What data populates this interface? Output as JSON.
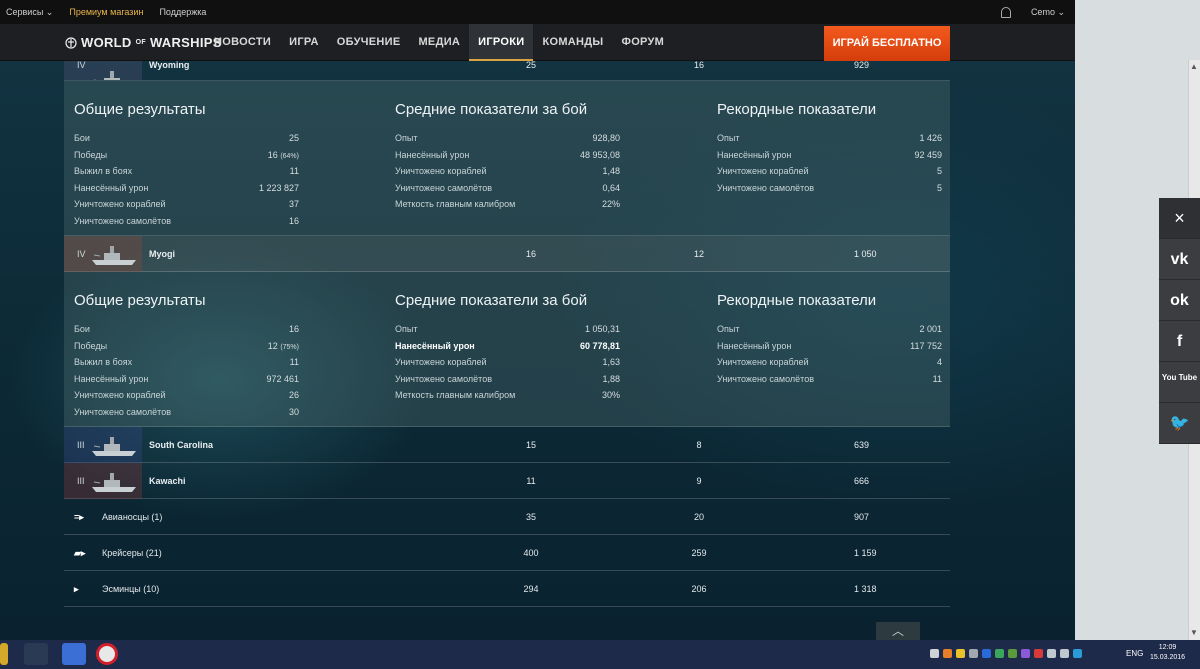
{
  "topbar": {
    "services": "Сервисы ⌄",
    "premium": "Премиум магазин",
    "support": "Поддержка",
    "user": "Cemo ⌄"
  },
  "nav": {
    "logo_a": "WORLD",
    "logo_b": "OF",
    "logo_c": "WARSHIPS",
    "items": [
      "НОВОСТИ",
      "ИГРА",
      "ОБУЧЕНИЕ",
      "МЕДИА",
      "ИГРОКИ",
      "КОМАНДЫ",
      "ФОРУМ"
    ],
    "active": "ИГРОКИ",
    "play": "ИГРАЙ БЕСПЛАТНО"
  },
  "partial_row": {
    "tier": "IV",
    "name": "Wyoming",
    "c1": "25",
    "c2": "16",
    "c3": "929"
  },
  "sections": [
    {
      "general": {
        "title": "Общие результаты",
        "rows": [
          {
            "k": "Бои",
            "v": "25",
            "p": ""
          },
          {
            "k": "Победы",
            "v": "16",
            "p": "(64%)"
          },
          {
            "k": "Выжил в боях",
            "v": "11",
            "p": ""
          },
          {
            "k": "Нанесённый урон",
            "v": "1 223 827",
            "p": ""
          },
          {
            "k": "Уничтожено кораблей",
            "v": "37",
            "p": ""
          },
          {
            "k": "Уничтожено самолётов",
            "v": "16",
            "p": ""
          }
        ]
      },
      "avg": {
        "title": "Средние показатели за бой",
        "rows": [
          {
            "k": "Опыт",
            "v": "928,80"
          },
          {
            "k": "Нанесённый урон",
            "v": "48 953,08"
          },
          {
            "k": "Уничтожено кораблей",
            "v": "1,48"
          },
          {
            "k": "Уничтожено самолётов",
            "v": "0,64"
          },
          {
            "k": "Меткость главным калибром",
            "v": "22%"
          }
        ]
      },
      "rec": {
        "title": "Рекордные показатели",
        "rows": [
          {
            "k": "Опыт",
            "v": "1 426"
          },
          {
            "k": "Нанесённый урон",
            "v": "92 459"
          },
          {
            "k": "Уничтожено кораблей",
            "v": "5"
          },
          {
            "k": "Уничтожено самолётов",
            "v": "5"
          }
        ]
      }
    },
    {
      "general": {
        "title": "Общие результаты",
        "rows": [
          {
            "k": "Бои",
            "v": "16",
            "p": ""
          },
          {
            "k": "Победы",
            "v": "12",
            "p": "(75%)"
          },
          {
            "k": "Выжил в боях",
            "v": "11",
            "p": ""
          },
          {
            "k": "Нанесённый урон",
            "v": "972 461",
            "p": ""
          },
          {
            "k": "Уничтожено кораблей",
            "v": "26",
            "p": ""
          },
          {
            "k": "Уничтожено самолётов",
            "v": "30",
            "p": ""
          }
        ]
      },
      "avg": {
        "title": "Средние показатели за бой",
        "rows": [
          {
            "k": "Опыт",
            "v": "1 050,31"
          },
          {
            "k": "Нанесённый урон",
            "v": "60 778,81"
          },
          {
            "k": "Уничтожено кораблей",
            "v": "1,63"
          },
          {
            "k": "Уничтожено самолётов",
            "v": "1,88"
          },
          {
            "k": "Меткость главным калибром",
            "v": "30%"
          }
        ]
      },
      "rec": {
        "title": "Рекордные показатели",
        "rows": [
          {
            "k": "Опыт",
            "v": "2 001"
          },
          {
            "k": "Нанесённый урон",
            "v": "117 752"
          },
          {
            "k": "Уничтожено кораблей",
            "v": "4"
          },
          {
            "k": "Уничтожено самолётов",
            "v": "11"
          }
        ]
      }
    }
  ],
  "ships": [
    {
      "tier": "IV",
      "name": "Myogi",
      "c1": "16",
      "c2": "12",
      "c3": "1 050"
    },
    {
      "tier": "III",
      "name": "South Carolina",
      "c1": "15",
      "c2": "8",
      "c3": "639"
    },
    {
      "tier": "III",
      "name": "Kawachi",
      "c1": "11",
      "c2": "9",
      "c3": "666"
    }
  ],
  "classes": [
    {
      "icon": "=▸",
      "name": "Авианосцы (1)",
      "c1": "35",
      "c2": "20",
      "c3": "907"
    },
    {
      "icon": "▰▸",
      "name": "Крейсеры (21)",
      "c1": "400",
      "c2": "259",
      "c3": "1 159"
    },
    {
      "icon": "▸",
      "name": "Эсминцы (10)",
      "c1": "294",
      "c2": "206",
      "c3": "1 318"
    }
  ],
  "social": [
    "×",
    "vk",
    "ok",
    "f",
    "You Tube",
    "🐦"
  ],
  "taskbar": {
    "lang": "ENG",
    "time": "12:09",
    "date": "15.03.2016"
  },
  "colors": {
    "accent": "#f45a1e",
    "nav_active_border": "#d9a441",
    "premium": "#e8b54a"
  }
}
